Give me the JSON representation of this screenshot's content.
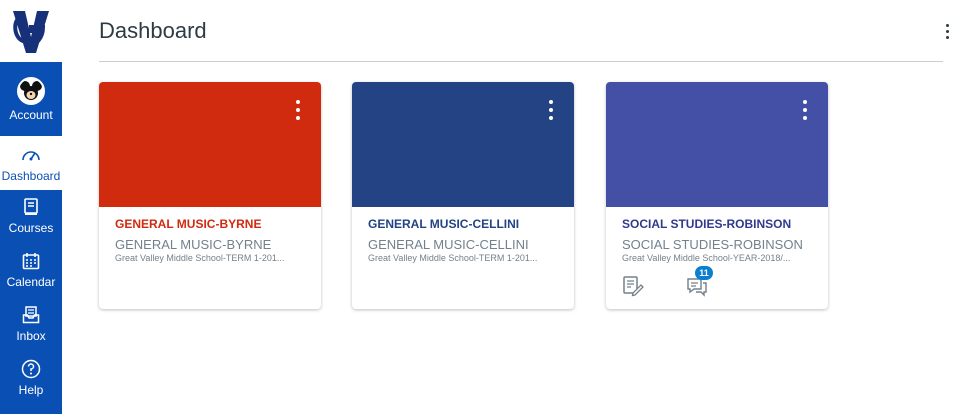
{
  "header": {
    "title": "Dashboard"
  },
  "nav": {
    "items": [
      {
        "label": "Account"
      },
      {
        "label": "Dashboard"
      },
      {
        "label": "Courses"
      },
      {
        "label": "Calendar"
      },
      {
        "label": "Inbox"
      },
      {
        "label": "Help"
      }
    ]
  },
  "cards": [
    {
      "name": "GENERAL MUSIC-BYRNE",
      "code": "GENERAL MUSIC-BYRNE",
      "term": "Great Valley Middle School-TERM 1-201...",
      "color": "#d12b0f"
    },
    {
      "name": "GENERAL MUSIC-CELLINI",
      "code": "GENERAL MUSIC-CELLINI",
      "term": "Great Valley Middle School-TERM 1-201...",
      "color": "#244384"
    },
    {
      "name": "SOCIAL STUDIES-ROBINSON",
      "code": "SOCIAL STUDIES-ROBINSON",
      "term": "Great Valley Middle School-YEAR-2018/...",
      "color": "#4450a5",
      "discussion_badge": "11"
    }
  ],
  "colors": {
    "nav_bg": "#0a50b4",
    "logo_blue": "#16317a"
  }
}
